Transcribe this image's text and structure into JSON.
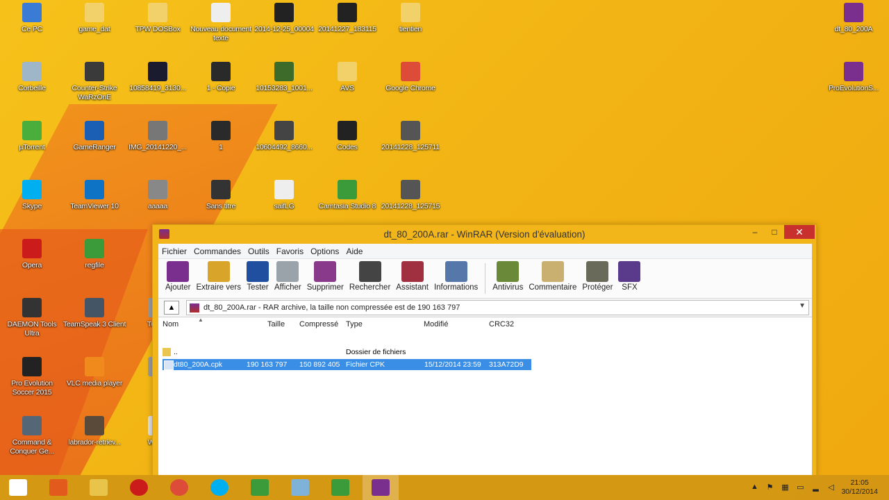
{
  "desktop": {
    "icons": [
      {
        "label": "Ce PC",
        "color": "#3a7bd5"
      },
      {
        "label": "game_dat",
        "color": "#f2d16b"
      },
      {
        "label": "TPW DOSBox",
        "color": "#f2d16b"
      },
      {
        "label": "Nouveau document texte",
        "color": "#eeeeee"
      },
      {
        "label": "2014-12-25_00004",
        "color": "#222222"
      },
      {
        "label": "20141227_183115",
        "color": "#222222"
      },
      {
        "label": "tientien",
        "color": "#f2d16b"
      },
      {
        "label": "dt_80_200A",
        "color": "#7a2f8f"
      },
      {
        "label": "Corbeille",
        "color": "#9fb6c8"
      },
      {
        "label": "Counter-Strike WaRzOnE",
        "color": "#3a3a3a"
      },
      {
        "label": "10858419_3130...",
        "color": "#1b1b30"
      },
      {
        "label": "1 - Copie",
        "color": "#2a2a2a"
      },
      {
        "label": "10153283_1001...",
        "color": "#3c6b2a"
      },
      {
        "label": "AVS",
        "color": "#f2d16b"
      },
      {
        "label": "Google Chrome",
        "color": "#dd4b39"
      },
      {
        "label": "ProEvolutionS...",
        "color": "#7a2f8f"
      },
      {
        "label": "µTorrent",
        "color": "#4aae3c"
      },
      {
        "label": "GameRanger",
        "color": "#1a5fb4"
      },
      {
        "label": "IMG_20141220_...",
        "color": "#777777"
      },
      {
        "label": "1",
        "color": "#2a2a2a"
      },
      {
        "label": "10604492_8660...",
        "color": "#444444"
      },
      {
        "label": "Codes",
        "color": "#222222"
      },
      {
        "label": "20141228_125711",
        "color": "#555555"
      },
      {
        "label": "Skype",
        "color": "#00aff0"
      },
      {
        "label": "TeamViewer 10",
        "color": "#0e72c5"
      },
      {
        "label": "aaaaa",
        "color": "#888888"
      },
      {
        "label": "Sans titre",
        "color": "#333333"
      },
      {
        "label": "saifLG",
        "color": "#eeeeee"
      },
      {
        "label": "Camtasia Studio 8",
        "color": "#3b9b3b"
      },
      {
        "label": "20141228_125715",
        "color": "#555555"
      },
      {
        "label": "Opera",
        "color": "#cc1b1b"
      },
      {
        "label": "regfile",
        "color": "#3b9b3b"
      },
      {
        "label": "DAEMON Tools Ultra",
        "color": "#333333"
      },
      {
        "label": "TeamSpeak 3 Client",
        "color": "#445566"
      },
      {
        "label": "TuneU",
        "color": "#999999"
      },
      {
        "label": "Pro Evolution Soccer 2015",
        "color": "#222222"
      },
      {
        "label": "VLC media player",
        "color": "#f08a1c"
      },
      {
        "label": "S",
        "color": "#999999"
      },
      {
        "label": "Command & Conquer Ge...",
        "color": "#556677"
      },
      {
        "label": "labrador-retriev...",
        "color": "#5a4a3a"
      },
      {
        "label": "Windo",
        "color": "#dddddd"
      }
    ]
  },
  "window": {
    "title": "dt_80_200A.rar - WinRAR (Version d'évaluation)",
    "buttons": {
      "minimize": "–",
      "maximize": "□",
      "close": "✕"
    },
    "menu": [
      "Fichier",
      "Commandes",
      "Outils",
      "Favoris",
      "Options",
      "Aide"
    ],
    "toolbar": [
      {
        "label": "Ajouter",
        "color": "#7a2f8f"
      },
      {
        "label": "Extraire vers",
        "color": "#d9a42a"
      },
      {
        "label": "Tester",
        "color": "#1f4f9e"
      },
      {
        "label": "Afficher",
        "color": "#9aa3aa"
      },
      {
        "label": "Supprimer",
        "color": "#8a3a8a"
      },
      {
        "label": "Rechercher",
        "color": "#444444"
      },
      {
        "label": "Assistant",
        "color": "#a03040"
      },
      {
        "label": "Informations",
        "color": "#5577aa"
      },
      {
        "label": "Antivirus",
        "color": "#6a8a3a"
      },
      {
        "label": "Commentaire",
        "color": "#c9b070"
      },
      {
        "label": "Protéger",
        "color": "#6a6a5a"
      },
      {
        "label": "SFX",
        "color": "#5a3a8a"
      }
    ],
    "path": "dt_80_200A.rar - RAR archive, la taille non compressée est de 190 163 797",
    "columns": {
      "name": "Nom",
      "size": "Taille",
      "packed": "Compressé",
      "type": "Type",
      "modified": "Modifié",
      "crc": "CRC32"
    },
    "rows": [
      {
        "name": "..",
        "size": "",
        "packed": "",
        "type": "Dossier de fichiers",
        "modified": "",
        "crc": ""
      },
      {
        "name": "dt80_200A.cpk",
        "size": "190 163 797",
        "packed": "150 892 405",
        "type": "Fichier CPK",
        "modified": "15/12/2014 23:59",
        "crc": "313A72D9"
      }
    ]
  },
  "taskbar": {
    "apps": [
      {
        "name": "start",
        "color": "#ffffff"
      },
      {
        "name": "media-player",
        "color": "#e25b1c"
      },
      {
        "name": "file-explorer",
        "color": "#e8c44a"
      },
      {
        "name": "opera",
        "color": "#cc1b1b"
      },
      {
        "name": "chrome",
        "color": "#dd4b39"
      },
      {
        "name": "skype",
        "color": "#00aff0"
      },
      {
        "name": "camtasia-recorder",
        "color": "#3b9b3b"
      },
      {
        "name": "notepad",
        "color": "#7fb2d8"
      },
      {
        "name": "camtasia-studio",
        "color": "#3b9b3b"
      },
      {
        "name": "winrar",
        "color": "#7a2f8f"
      }
    ],
    "time": "21:05",
    "date": "30/12/2014"
  }
}
